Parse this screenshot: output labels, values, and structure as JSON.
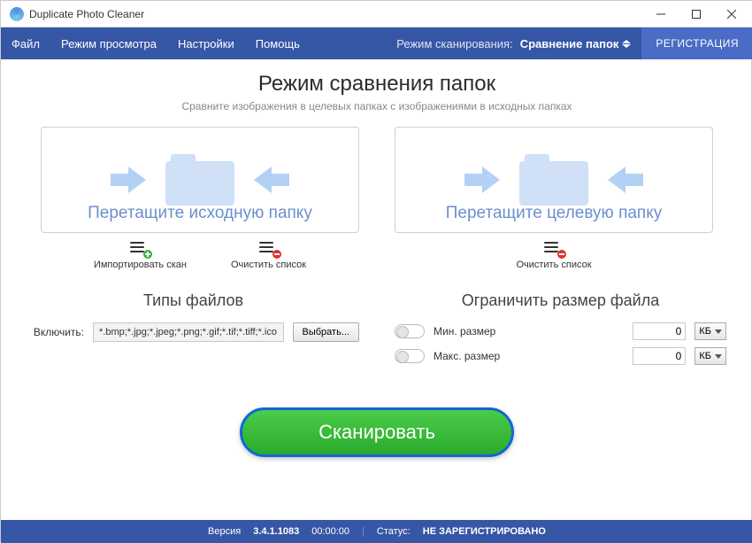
{
  "window": {
    "title": "Duplicate Photo Cleaner"
  },
  "menu": {
    "file": "Файл",
    "view": "Режим просмотра",
    "settings": "Настройки",
    "help": "Помощь",
    "scan_mode_label": "Режим сканирования:",
    "scan_mode_value": "Сравнение папок",
    "register": "РЕГИСТРАЦИЯ"
  },
  "page": {
    "title": "Режим сравнения папок",
    "subtitle": "Сравните изображения в целевых папках с изображениями в исходных папках"
  },
  "dropzones": {
    "source": "Перетащите исходную папку",
    "target": "Перетащите целевую папку"
  },
  "actions": {
    "import_scan": "Импортировать скан",
    "clear_list": "Очистить список"
  },
  "filetypes": {
    "heading": "Типы файлов",
    "include_label": "Включить:",
    "value": "*.bmp;*.jpg;*.jpeg;*.png;*.gif;*.tif;*.tiff;*.ico;*.wmp;*.psd;*.raw",
    "pick": "Выбрать..."
  },
  "filesize": {
    "heading": "Ограничить размер файла",
    "min_label": "Мин. размер",
    "max_label": "Макс. размер",
    "min_value": "0",
    "max_value": "0",
    "unit": "КБ"
  },
  "scan_button": "Сканировать",
  "status": {
    "version_label": "Версия",
    "version": "3.4.1.1083",
    "time": "00:00:00",
    "status_label": "Статус:",
    "status_value": "НЕ ЗАРЕГИСТРИРОВАНО"
  }
}
